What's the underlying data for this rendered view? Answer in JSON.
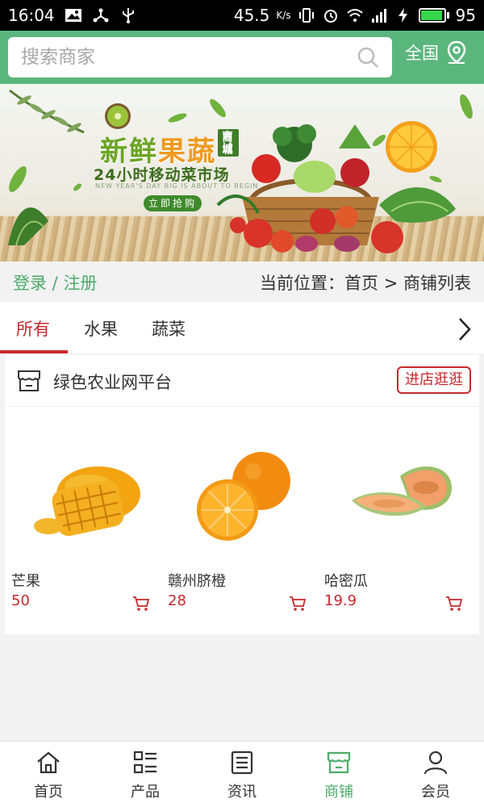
{
  "status_bar": {
    "time": "16:04",
    "net_speed": "45.5",
    "net_unit": "K/s",
    "battery": "95",
    "battery_level": 0.95
  },
  "search": {
    "placeholder": "搜索商家",
    "region_label": "全国"
  },
  "banner": {
    "title_part1": "新鲜",
    "title_part2": "果蔬",
    "title_tag": "商城",
    "subtitle": "24小时移动菜市场",
    "english": "NEW YEAR'S DAY BIG IS ABOUT TO BEGIN",
    "cta": "立即抢购"
  },
  "auth": {
    "login": "登录",
    "separator": " / ",
    "register": "注册"
  },
  "breadcrumb": {
    "text": "当前位置：首页 > 商铺列表"
  },
  "tabs": [
    {
      "label": "所有",
      "active": true
    },
    {
      "label": "水果",
      "active": false
    },
    {
      "label": "蔬菜",
      "active": false
    }
  ],
  "shop": {
    "name": "绿色农业网平台",
    "enter_label": "进店逛逛",
    "products": [
      {
        "name": "芒果",
        "price": "50",
        "image": "mango"
      },
      {
        "name": "赣州脐橙",
        "price": "28",
        "image": "orange"
      },
      {
        "name": "哈密瓜",
        "price": "19.9",
        "image": "melon"
      }
    ]
  },
  "bottom_nav": [
    {
      "label": "首页",
      "icon": "home-icon",
      "active": false
    },
    {
      "label": "产品",
      "icon": "grid-list-icon",
      "active": false
    },
    {
      "label": "资讯",
      "icon": "news-icon",
      "active": false
    },
    {
      "label": "商铺",
      "icon": "shop-icon",
      "active": true
    },
    {
      "label": "会员",
      "icon": "user-icon",
      "active": false
    }
  ],
  "colors": {
    "brand_green": "#5ab67d",
    "accent_red": "#c8282d",
    "link_green": "#4cab6a"
  }
}
